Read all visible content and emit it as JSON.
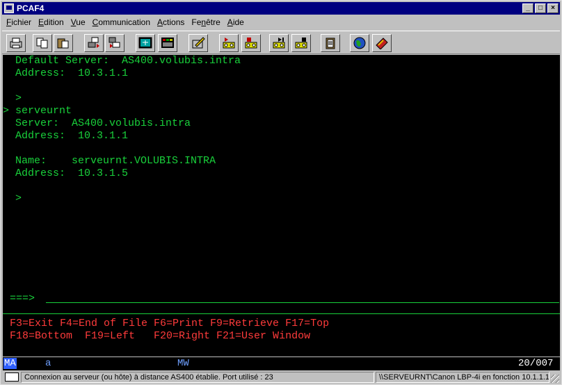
{
  "window": {
    "title": "PCAF4",
    "controls": [
      "minimize",
      "maximize",
      "close"
    ]
  },
  "menu": [
    {
      "label": "Fichier",
      "key": "F"
    },
    {
      "label": "Edition",
      "key": "E"
    },
    {
      "label": "Vue",
      "key": "V"
    },
    {
      "label": "Communication",
      "key": "C"
    },
    {
      "label": "Actions",
      "key": "A"
    },
    {
      "label": "Fenêtre",
      "key": "n"
    },
    {
      "label": "Aide",
      "key": "A"
    }
  ],
  "toolbar": [
    "print-icon",
    "copy-icon",
    "paste-icon",
    "send-file-icon",
    "receive-file-icon",
    "display-setup-icon",
    "keypad-icon",
    "edit-macro-icon",
    "record-macro-icon",
    "stop-macro-icon",
    "play-macro-icon",
    "pause-macro-icon",
    "clipboard-icon",
    "web-globe-icon",
    "help-book-icon"
  ],
  "terminal": {
    "lines": [
      "  Default Server:  AS400.volubis.intra",
      "  Address:  10.3.1.1",
      "",
      "  >",
      "> serveurnt",
      "  Server:  AS400.volubis.intra",
      "  Address:  10.3.1.1",
      "",
      "  Name:    serveurnt.VOLUBIS.INTRA",
      "  Address:  10.3.1.5",
      "",
      "  >"
    ],
    "prompt": "===>",
    "fkeys_line1": "F3=Exit F4=End of File F6=Print F9=Retrieve F17=Top",
    "fkeys_line2": "F18=Bottom  F19=Left   F20=Right F21=User Window"
  },
  "oia": {
    "ma": "MA",
    "session": "a",
    "mw": "MW",
    "cursor_pos": "20/007"
  },
  "statusbar": {
    "message": "Connexion au serveur (ou hôte) à distance AS400 établie. Port utilisé : 23",
    "printer": "\\\\SERVEURNT\\Canon LBP-4i en fonction 10.1.1.1"
  },
  "colors": {
    "terminal_green": "#19d13b",
    "terminal_red": "#ff3b3b",
    "title_blue": "#000080"
  }
}
